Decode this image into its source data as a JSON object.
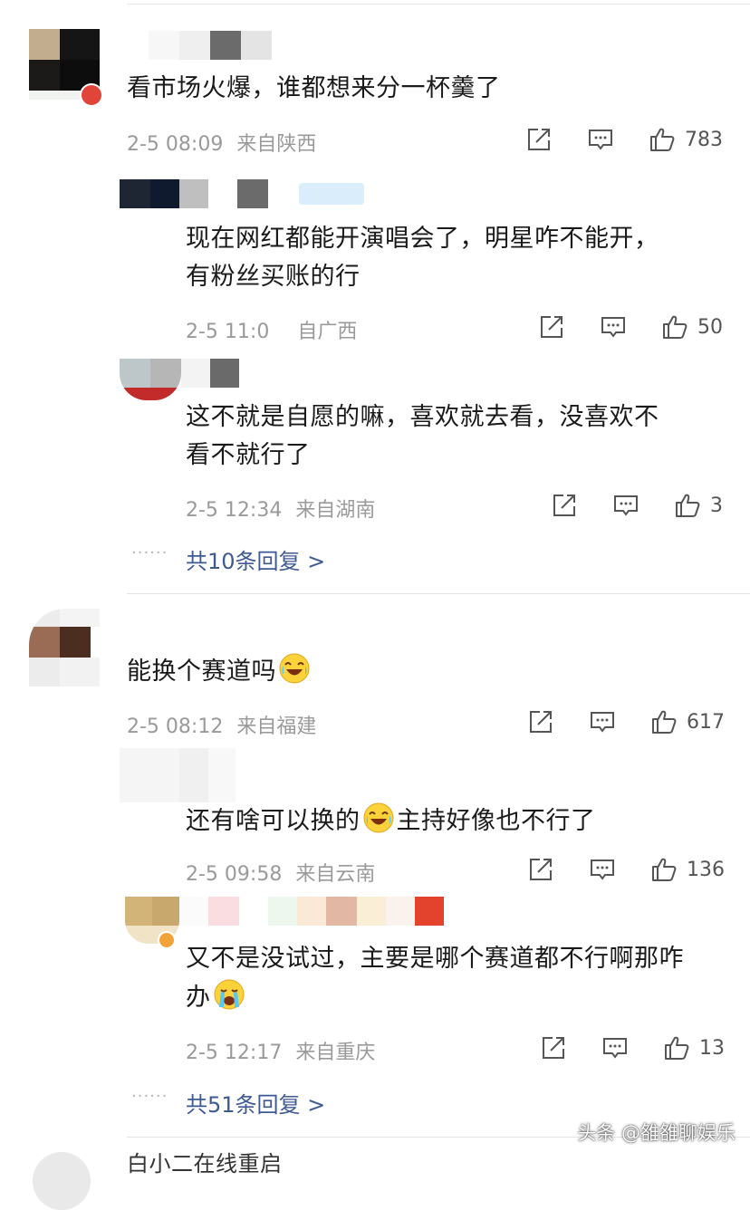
{
  "comments": [
    {
      "text": "看市场火爆，谁都想来分一杯羹了",
      "time": "2-5 08:09",
      "location": "来自陕西",
      "likes": "783",
      "replies": [
        {
          "line1": "现在网红都能开演唱会了，明星咋不能开，",
          "line2": "有粉丝买账的行",
          "time": "2-5 11:0",
          "location": "自广西",
          "likes": "50"
        },
        {
          "line1": "这不就是自愿的嘛，喜欢就去看，没喜欢不",
          "line2": "看不就行了",
          "time": "2-5 12:34",
          "location": "来自湖南",
          "likes": "3"
        }
      ],
      "more_replies": "共10条回复 >"
    },
    {
      "text": "能换个赛道吗",
      "time": "2-5 08:12",
      "location": "来自福建",
      "likes": "617",
      "replies": [
        {
          "line1a": "还有啥可以换的",
          "line1b": "主持好像也不行了",
          "time": "2-5 09:58",
          "location": "来自云南",
          "likes": "136"
        },
        {
          "line1": "又不是没试过，主要是哪个赛道都不行啊那咋",
          "line2": "办",
          "time": "2-5 12:17",
          "location": "来自重庆",
          "likes": "13"
        }
      ],
      "more_replies": "共51条回复 >"
    }
  ],
  "partial_bottom_text": "白小二在线重启",
  "watermark": "头条 @雒雒聊娱乐",
  "icons": {
    "share": "share-icon",
    "comment": "comment-icon",
    "like": "thumbs-up-icon",
    "emoji_laugh_cry": "laugh-cry-emoji-icon",
    "emoji_crying": "crying-emoji-icon"
  },
  "colors": {
    "more_link": "#3d5a93",
    "meta": "#9a9a9a",
    "badge_red": "#e1453a"
  }
}
